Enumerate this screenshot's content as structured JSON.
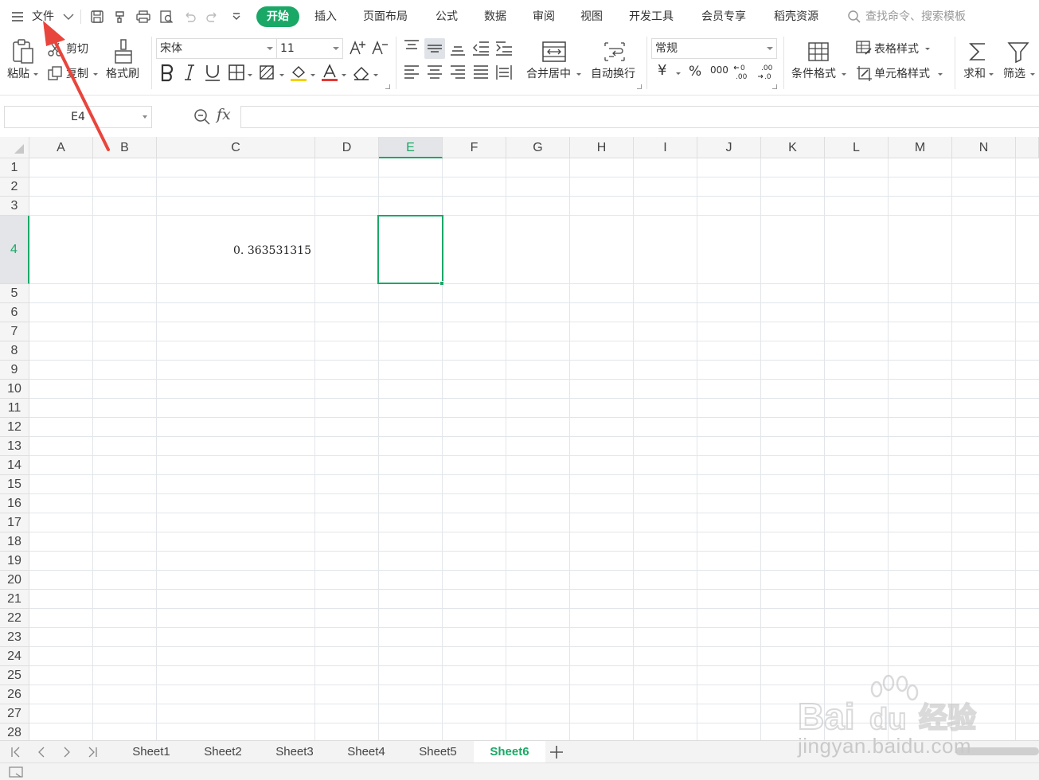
{
  "menubar": {
    "file_label": "文件",
    "tabs": [
      "开始",
      "插入",
      "页面布局",
      "公式",
      "数据",
      "审阅",
      "视图",
      "开发工具",
      "会员专享",
      "稻壳资源"
    ],
    "search_placeholder": "查找命令、搜索模板",
    "quick_access_icons": [
      "save-icon",
      "format-painter-icon",
      "print-icon",
      "print-preview-icon",
      "undo-icon",
      "redo-icon",
      "customize-icon"
    ]
  },
  "ribbon": {
    "paste": "粘贴",
    "cut": "剪切",
    "copy": "复制",
    "format_painter": "格式刷",
    "font_name": "宋体",
    "font_size": "11",
    "merge_center": "合并居中",
    "wrap_text": "自动换行",
    "number_format": "常规",
    "currency_symbol": "¥",
    "percent_symbol": "%",
    "thousands_symbol": "000",
    "conditional_format": "条件格式",
    "table_style": "表格样式",
    "cell_style": "单元格样式",
    "sum": "求和",
    "filter": "筛选"
  },
  "formulabar": {
    "name_box": "E4",
    "fx": "fx",
    "formula": ""
  },
  "grid": {
    "columns": [
      "A",
      "B",
      "C",
      "D",
      "E",
      "F",
      "G",
      "H",
      "I",
      "J",
      "K",
      "L",
      "M",
      "N"
    ],
    "rows": [
      "1",
      "2",
      "3",
      "4",
      "5",
      "6",
      "7",
      "8",
      "9",
      "10",
      "11",
      "12",
      "13",
      "14",
      "15",
      "16",
      "17",
      "18",
      "19",
      "20",
      "21",
      "22",
      "23",
      "24",
      "25",
      "26",
      "27",
      "28"
    ],
    "active_cell": "E4",
    "cell_c4": "0. 363531315"
  },
  "sheets": {
    "tabs": [
      "Sheet1",
      "Sheet2",
      "Sheet3",
      "Sheet4",
      "Sheet5",
      "Sheet6"
    ],
    "active": "Sheet6"
  },
  "watermark": {
    "text": "jingyan.baidu.com"
  },
  "colors": {
    "accent": "#1aa866",
    "annotation": "#e8453c"
  }
}
